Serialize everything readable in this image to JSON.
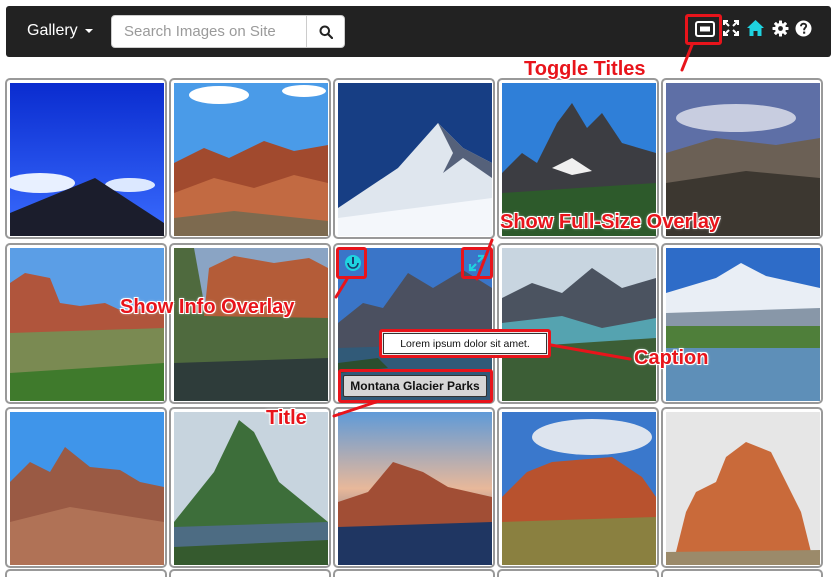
{
  "navbar": {
    "brand_label": "Gallery",
    "search_placeholder": "Search Images on Site",
    "icons": [
      "toggle-titles-icon",
      "fullscreen-icon",
      "home-icon",
      "settings-icon",
      "help-icon"
    ],
    "home_icon_color": "#1fd3e0"
  },
  "gallery": {
    "tiles": [
      {
        "subject": "dark mountain peak under blue sky"
      },
      {
        "subject": "red rock formations"
      },
      {
        "subject": "snowy mountain peak"
      },
      {
        "subject": "jagged alpine peaks"
      },
      {
        "subject": "cloudy mountain valley"
      },
      {
        "subject": "red rock buttes with green brush"
      },
      {
        "subject": "red cliffs above creek"
      },
      {
        "subject": "Montana Glacier Parks"
      },
      {
        "subject": "mountain lake valley"
      },
      {
        "subject": "snow-capped mountain over lake"
      },
      {
        "subject": "red rock mountains"
      },
      {
        "subject": "green pyramid peak over lake"
      },
      {
        "subject": "red mountain above lake at dusk"
      },
      {
        "subject": "red mesa with green trees"
      },
      {
        "subject": "orange rock spires"
      }
    ],
    "active_tile": {
      "title": "Montana Glacier Parks",
      "caption": "Lorem ipsum dolor sit amet."
    }
  },
  "annotations": {
    "toggle_titles": "Toggle Titles",
    "show_full_size_overlay": "Show Full-Size Overlay",
    "show_info_overlay": "Show Info Overlay",
    "caption": "Caption",
    "title": "Title",
    "color": "#e8141b"
  }
}
